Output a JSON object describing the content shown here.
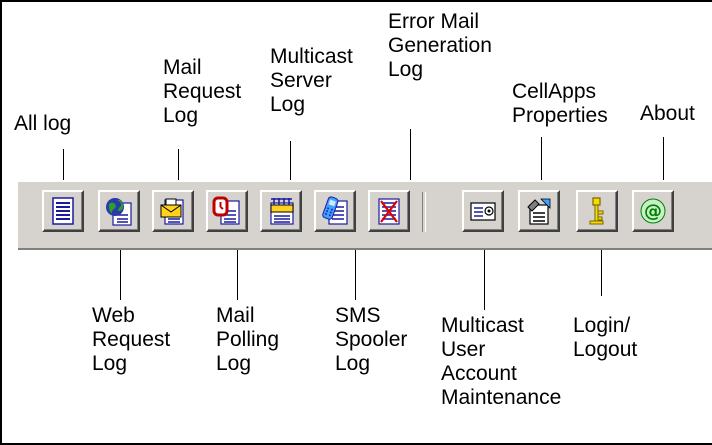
{
  "toolbar": {
    "buttons": [
      {
        "id": "all-log",
        "icon": "document-lines-icon",
        "label": "All log"
      },
      {
        "id": "web-request-log",
        "icon": "globe-document-icon",
        "label": "Web\nRequest\nLog"
      },
      {
        "id": "mail-request-log",
        "icon": "envelope-document-icon",
        "label": "Mail\nRequest\nLog"
      },
      {
        "id": "mail-polling-log",
        "icon": "clock-document-icon",
        "label": "Mail\nPolling\nLog"
      },
      {
        "id": "multicast-server-log",
        "icon": "multicast-document-icon",
        "label": "Multicast\nServer\nLog"
      },
      {
        "id": "sms-spooler-log",
        "icon": "mobile-document-icon",
        "label": "SMS\nSpooler\nLog"
      },
      {
        "id": "error-mail-generation-log",
        "icon": "error-document-icon",
        "label": "Error Mail\nGeneration\nLog"
      },
      {
        "id": "multicast-user-account-maintenance",
        "icon": "user-card-icon",
        "label": "Multicast\nUser\nAccount\nMaintenance"
      },
      {
        "id": "cellapps-properties",
        "icon": "properties-icon",
        "label": "CellApps\nProperties"
      },
      {
        "id": "login-logout",
        "icon": "key-icon",
        "label": "Login/\nLogout"
      },
      {
        "id": "about",
        "icon": "at-sign-icon",
        "label": "About"
      }
    ]
  },
  "colors": {
    "toolbar_face": "#d6d3ce",
    "doc_lines": "#1a1a9e",
    "error_red": "#e00000",
    "key_yellow": "#f0e000",
    "about_green": "#008000"
  }
}
